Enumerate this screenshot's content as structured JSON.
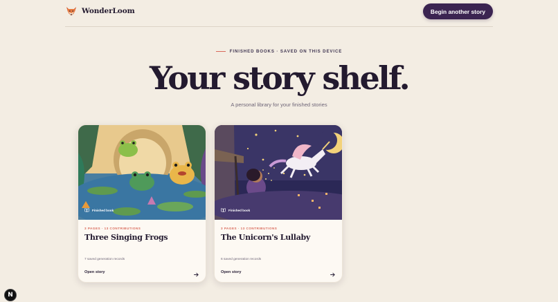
{
  "header": {
    "brand_name": "WonderLoom",
    "cta_label": "Begin another story"
  },
  "hero": {
    "eyebrow": "FINISHED BOOKS · SAVED ON THIS DEVICE",
    "title": "Your story shelf.",
    "subtitle": "A personal library for your finished stories"
  },
  "cards": [
    {
      "badge": "Finished book",
      "meta": "3 PAGES · 13 CONTRIBUTIONS",
      "title": "Three Singing Frogs",
      "records": "7 saved generation records",
      "open_label": "Open story"
    },
    {
      "badge": "Finished book",
      "meta": "3 PAGES · 13 CONTRIBUTIONS",
      "title": "The Unicorn's Lullaby",
      "records": "6 saved generation records",
      "open_label": "Open story"
    }
  ],
  "dev_badge": "N",
  "colors": {
    "background": "#f3ede3",
    "primary": "#3b2451",
    "accent": "#d9695a",
    "card": "#fdf9f3"
  },
  "icons": {
    "brand": "fox-icon",
    "badge": "book-icon",
    "open": "arrow-right-icon"
  }
}
